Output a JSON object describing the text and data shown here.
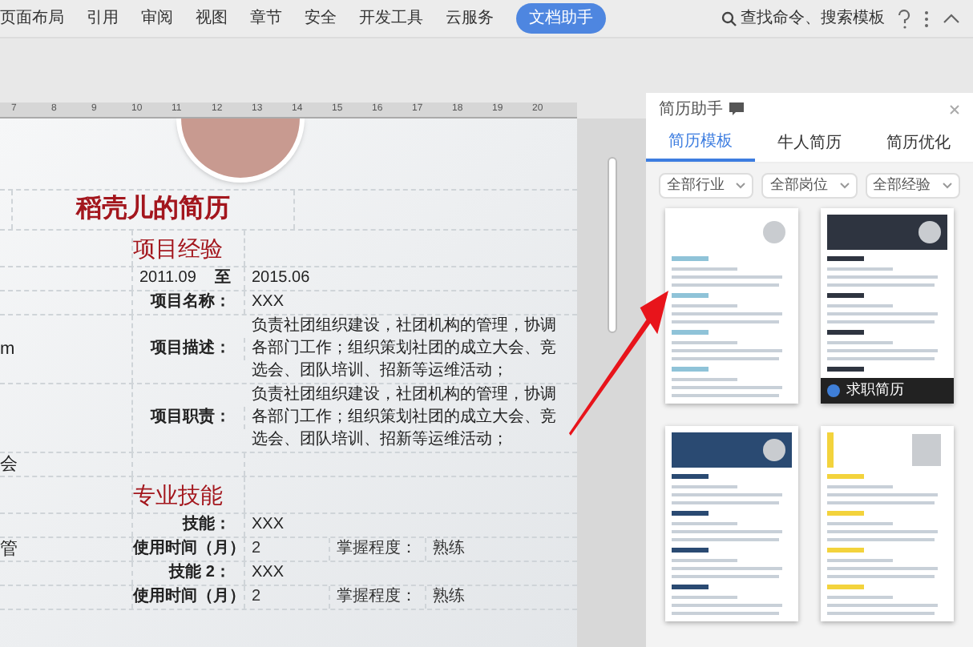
{
  "ribbon": {
    "tabs": [
      {
        "label": "页面布局",
        "selected": false
      },
      {
        "label": "引用",
        "selected": false
      },
      {
        "label": "审阅",
        "selected": false
      },
      {
        "label": "视图",
        "selected": false
      },
      {
        "label": "章节",
        "selected": false
      },
      {
        "label": "安全",
        "selected": false
      },
      {
        "label": "开发工具",
        "selected": false
      },
      {
        "label": "云服务",
        "selected": false
      },
      {
        "label": "文档助手",
        "selected": true
      }
    ],
    "search": "查找命令、搜索模板"
  },
  "ruler": {
    "marks": [
      "7",
      "8",
      "9",
      "10",
      "11",
      "12",
      "13",
      "14",
      "15",
      "16",
      "17",
      "18",
      "19",
      "20"
    ]
  },
  "document": {
    "title": "稻壳儿的简历",
    "rows": [
      {
        "kind": "heading",
        "text": "项目经验"
      },
      {
        "kind": "dates",
        "from": "2011.09",
        "sep": "至",
        "to": "2015.06"
      },
      {
        "kind": "field",
        "label": "项目名称：",
        "value": "XXX"
      },
      {
        "kind": "field",
        "label": "项目描述：",
        "value": "负责社团组织建设，社团机构的管理，协调各部门工作；组织策划社团的成立大会、竞选会、团队培训、招新等运维活动；",
        "left": "m"
      },
      {
        "kind": "field",
        "label": "项目职责：",
        "value": "负责社团组织建设，社团机构的管理，协调各部门工作；组织策划社团的成立大会、竞选会、团队培训、招新等运维活动；"
      },
      {
        "kind": "blank",
        "left": "会"
      },
      {
        "kind": "heading",
        "text": "专业技能"
      },
      {
        "kind": "field",
        "label": "技能：",
        "value": "XXX"
      },
      {
        "kind": "skill",
        "label": "使用时间（月）",
        "value": "2",
        "label2": "掌握程度：",
        "value2": "熟练",
        "left": "管"
      },
      {
        "kind": "field",
        "label": "技能 2：",
        "value": "XXX"
      },
      {
        "kind": "skill",
        "label": "使用时间（月）",
        "value": "2",
        "label2": "掌握程度：",
        "value2": "熟练"
      }
    ]
  },
  "panel": {
    "title": "简历助手",
    "tabs": [
      {
        "label": "简历模板",
        "selected": true
      },
      {
        "label": "牛人简历",
        "selected": false
      },
      {
        "label": "简历优化",
        "selected": false
      }
    ],
    "filters": [
      "全部行业",
      "全部岗位",
      "全部经验"
    ],
    "templates": [
      {
        "kind": "plain"
      },
      {
        "kind": "dark",
        "banner": "求职简历"
      },
      {
        "kind": "blue"
      },
      {
        "kind": "yellow"
      }
    ]
  }
}
